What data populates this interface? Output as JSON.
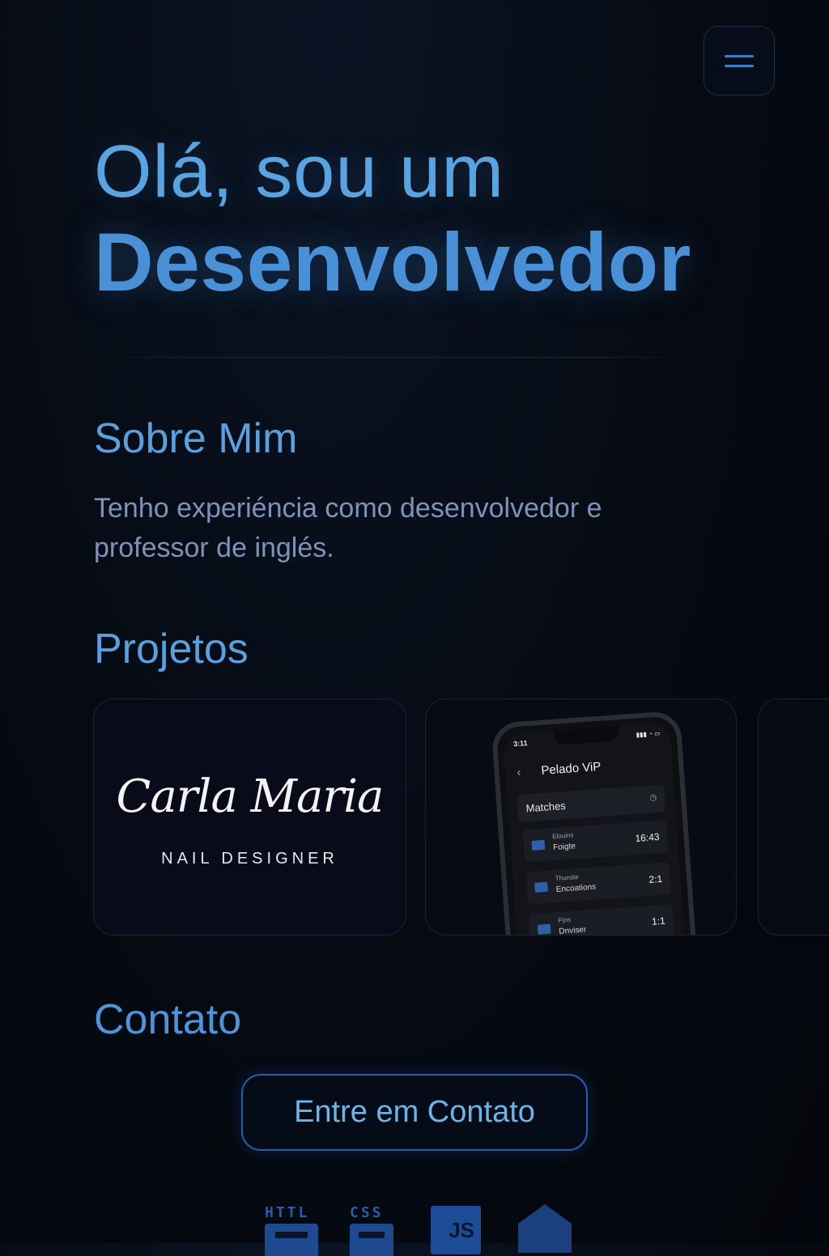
{
  "header": {
    "menu_icon": "hamburger-menu-icon"
  },
  "hero": {
    "line1": "Olá, sou um",
    "line2": "Desenvolvedor"
  },
  "about": {
    "title": "Sobre Mim",
    "text": "Tenho experiéncia como desenvolvedor e professor de inglés."
  },
  "projects": {
    "title": "Projetos",
    "items": [
      {
        "logo_script": "Carla Maria",
        "logo_sub": "NAIL DESIGNER"
      },
      {
        "phone_time": "3:11",
        "app_title": "Pelado ViP",
        "matches_label": "Matches",
        "rows": [
          {
            "line1": "Elouins",
            "line2": "Foigte",
            "score": "16:43"
          },
          {
            "line1": "Thunste",
            "line2": "Encoations",
            "score": "2:1"
          },
          {
            "line1": "Pjos",
            "line2": "Dnviser",
            "score": "1:1"
          }
        ]
      },
      {}
    ]
  },
  "contact": {
    "title": "Contato",
    "button_label": "Entre em Contato"
  },
  "tech_icons": {
    "html_label": "HTTL",
    "css_label": "CSS",
    "js_label": "JS"
  },
  "colors": {
    "accent": "#4a90d6",
    "background": "#05080f",
    "muted_text": "#7d93b8"
  }
}
